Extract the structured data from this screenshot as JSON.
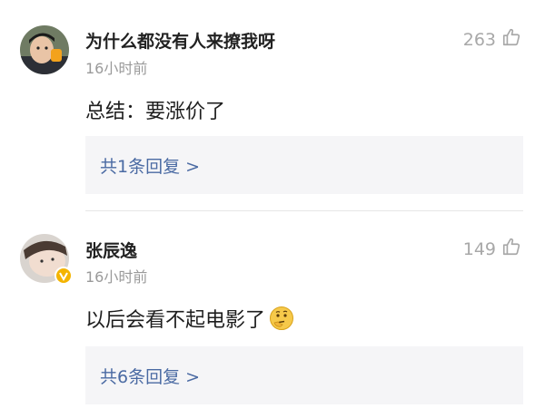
{
  "comments": [
    {
      "username": "为什么都没有人来撩我呀",
      "time": "16小时前",
      "likes": "263",
      "text": "总结：要涨价了",
      "reply_link": "共1条回复 >"
    },
    {
      "username": "张辰逸",
      "time": "16小时前",
      "likes": "149",
      "text": "以后会看不起电影了",
      "reply_link": "共6条回复 >",
      "verified": true
    }
  ],
  "colors": {
    "link": "#4a6aa3",
    "muted": "#9a9a9a",
    "reply_bg": "#f5f5f7",
    "badge": "#f4b400"
  },
  "icons": {
    "like": "thumbs-up-icon",
    "emoji": "thinking-face-emoji-icon",
    "verified": "verified-badge-icon"
  }
}
